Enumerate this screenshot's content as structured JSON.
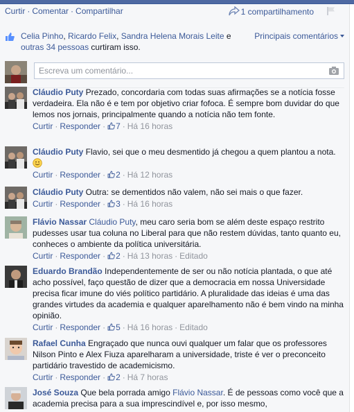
{
  "actions": {
    "curtir": "Curtir",
    "comentar": "Comentar",
    "compartilhar": "Compartilhar",
    "share_count": "1 compartilhamento"
  },
  "likes": {
    "names": [
      "Celia Pinho",
      "Ricardo Felix",
      "Sandra Helena Morais Leite"
    ],
    "sep1": ", ",
    "sep2": ", ",
    "and": " e",
    "others": "outras 34 pessoas",
    "suffix": " curtiram isso.",
    "sort_label": "Principais comentários"
  },
  "composer": {
    "placeholder": "Escreva um comentário..."
  },
  "meta_labels": {
    "like": "Curtir",
    "reply": "Responder",
    "edited": "Editado"
  },
  "comments": [
    {
      "author": "Cláudio Puty",
      "text": " Prezado, concordaria com todas suas afirmações se a notícia fosse verdadeira. Ela não é e tem por objetivo criar fofoca. É sempre bom duvidar do que lemos nos jornais, principalmente quando a notícia não tem fonte.",
      "likes": "7",
      "time": "Há 16 horas"
    },
    {
      "author": "Cláudio Puty",
      "text": " Flavio, sei que o meu desmentido já chegou a quem plantou a nota. ",
      "likes": "2",
      "time": "Há 12 horas"
    },
    {
      "author": "Cláudio Puty",
      "text": " Outra: se dementidos não valem, não sei mais o que fazer.",
      "likes": "3",
      "time": "Há 16 horas"
    },
    {
      "author": "Flávio Nassar",
      "mention": "Cláudio Puty",
      "text": ", meu caro seria bom se além deste espaço restrito pudesses usar tua coluna no Liberal para que não restem dúvidas, tanto quanto eu, conheces o ambiente da política universitária.",
      "likes": "2",
      "time": "Há 13 horas"
    },
    {
      "author": "Eduardo Brandão",
      "text": " Independentemente de ser ou não notícia plantada, o que até acho possível, faço questão de dizer que a democracia em nossa Universidade precisa ficar imune do viés político partidário. A pluralidade das ideias é uma das grandes virtudes da academia e qualquer aparelhamento não é bem vindo na minha opinião.",
      "likes": "5",
      "time": "Há 16 horas"
    },
    {
      "author": "Rafael Cunha",
      "text": " Engraçado que nunca ouvi qualquer um falar que os professores Nilson Pinto e Alex Fiuza aparelharam a universidade, triste é ver o preconceito partidário travestido de academicismo.",
      "likes": "2",
      "time": "Há 7 horas"
    },
    {
      "author": "José Souza",
      "text_before": " Que bela porrada amigo ",
      "mention": "Flávio Nassar",
      "text": ". É de pessoas como você que a academia precisa para a sua imprescindível e, por isso mesmo,"
    }
  ]
}
